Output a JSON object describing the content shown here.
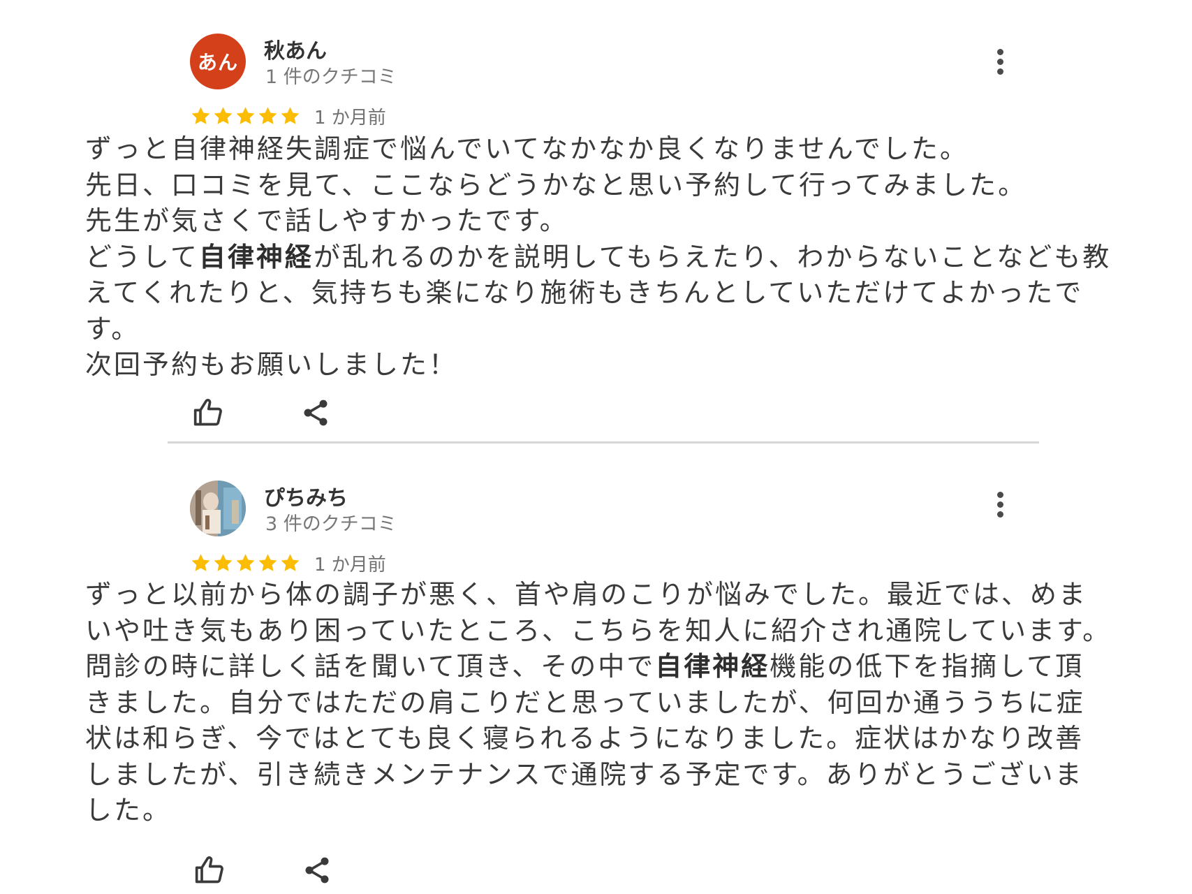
{
  "reviews": [
    {
      "avatar_text": "あん",
      "avatar_color": "#d4401a",
      "name": "秋あん",
      "review_count": "1 件のクチコミ",
      "rating": 5,
      "date": "1 か月前",
      "body": {
        "p1": "ずっと自律神経失調症で悩んでいてなかなか良くなりませんでした。\n先日、口コミを見て、ここならどうかなと思い予約して行ってみました。\n先生が気さくで話しやすかったです。\nどうして",
        "highlight": "自律神経",
        "p2": "が乱れるのかを説明してもらえたり、わからないことなども教えてくれたりと、気持ちも楽になり施術もきちんとしていただけてよかったです。\n次回予約もお願いしました！"
      },
      "icons": {
        "menu": "more-vert-icon",
        "like": "thumb-up-icon",
        "share": "share-icon"
      }
    },
    {
      "avatar_image": "profile-photo",
      "name": "ぴちみち",
      "review_count": "3 件のクチコミ",
      "rating": 5,
      "date": "1 か月前",
      "body": {
        "p1": "ずっと以前から体の調子が悪く、首や肩のこりが悩みでした。最近では、めまいや吐き気もあり困っていたところ、こちらを知人に紹介され通院しています。問診の時に詳しく話を聞いて頂き、その中で",
        "highlight": "自律神経",
        "p2": "機能の低下を指摘して頂きました。自分ではただの肩こりだと思っていましたが、何回か通ううちに症状は和らぎ、今ではとても良く寝られるようになりました。症状はかなり改善しましたが、引き続きメンテナンスで通院する予定です。ありがとうございました。"
      },
      "icons": {
        "menu": "more-vert-icon",
        "like": "thumb-up-icon",
        "share": "share-icon"
      }
    }
  ],
  "colors": {
    "star": "#fbbc04",
    "text": "#3a3a3a",
    "secondary_text": "#777777",
    "divider": "#d6d6d6"
  }
}
